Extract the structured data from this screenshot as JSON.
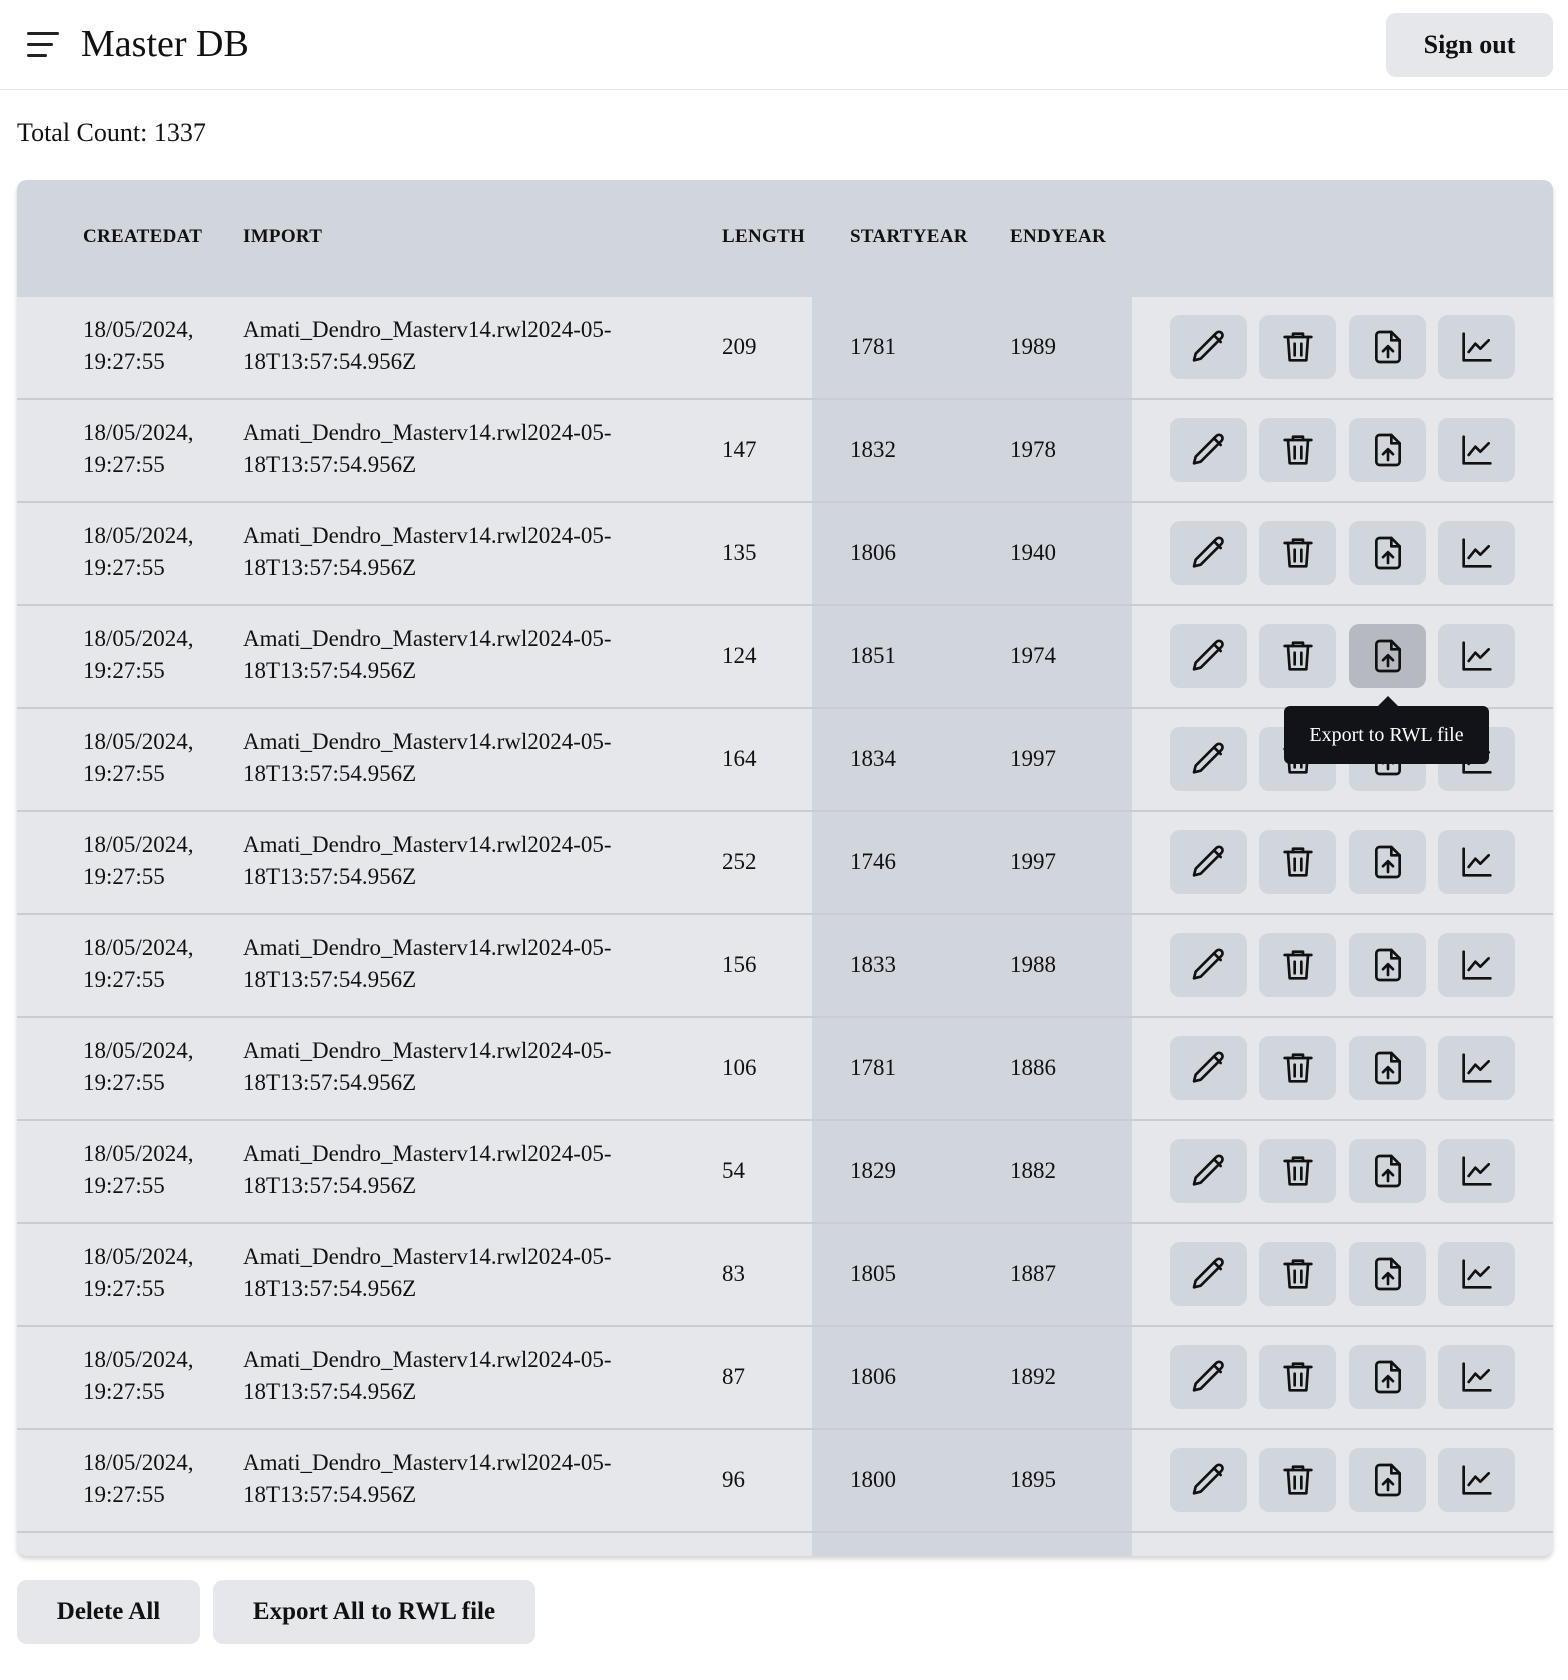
{
  "header": {
    "title": "Master DB",
    "signout_label": "Sign out",
    "menu_icon": "hamburger-menu-icon"
  },
  "summary": {
    "total_count": "Total Count: 1337"
  },
  "table": {
    "columns": [
      "CREATEDAT",
      "IMPORT",
      "LENGTH",
      "STARTYEAR",
      "ENDYEAR"
    ],
    "rows": [
      {
        "created_date": "18/05/2024,",
        "created_time": "19:27:55",
        "import_line1": "Amati_Dendro_Masterv14.rwl2024-05-",
        "import_line2": "18T13:57:54.956Z",
        "length": "209",
        "startyear": "1781",
        "endyear": "1989"
      },
      {
        "created_date": "18/05/2024,",
        "created_time": "19:27:55",
        "import_line1": "Amati_Dendro_Masterv14.rwl2024-05-",
        "import_line2": "18T13:57:54.956Z",
        "length": "147",
        "startyear": "1832",
        "endyear": "1978"
      },
      {
        "created_date": "18/05/2024,",
        "created_time": "19:27:55",
        "import_line1": "Amati_Dendro_Masterv14.rwl2024-05-",
        "import_line2": "18T13:57:54.956Z",
        "length": "135",
        "startyear": "1806",
        "endyear": "1940"
      },
      {
        "created_date": "18/05/2024,",
        "created_time": "19:27:55",
        "import_line1": "Amati_Dendro_Masterv14.rwl2024-05-",
        "import_line2": "18T13:57:54.956Z",
        "length": "124",
        "startyear": "1851",
        "endyear": "1974"
      },
      {
        "created_date": "18/05/2024,",
        "created_time": "19:27:55",
        "import_line1": "Amati_Dendro_Masterv14.rwl2024-05-",
        "import_line2": "18T13:57:54.956Z",
        "length": "164",
        "startyear": "1834",
        "endyear": "1997"
      },
      {
        "created_date": "18/05/2024,",
        "created_time": "19:27:55",
        "import_line1": "Amati_Dendro_Masterv14.rwl2024-05-",
        "import_line2": "18T13:57:54.956Z",
        "length": "252",
        "startyear": "1746",
        "endyear": "1997"
      },
      {
        "created_date": "18/05/2024,",
        "created_time": "19:27:55",
        "import_line1": "Amati_Dendro_Masterv14.rwl2024-05-",
        "import_line2": "18T13:57:54.956Z",
        "length": "156",
        "startyear": "1833",
        "endyear": "1988"
      },
      {
        "created_date": "18/05/2024,",
        "created_time": "19:27:55",
        "import_line1": "Amati_Dendro_Masterv14.rwl2024-05-",
        "import_line2": "18T13:57:54.956Z",
        "length": "106",
        "startyear": "1781",
        "endyear": "1886"
      },
      {
        "created_date": "18/05/2024,",
        "created_time": "19:27:55",
        "import_line1": "Amati_Dendro_Masterv14.rwl2024-05-",
        "import_line2": "18T13:57:54.956Z",
        "length": "54",
        "startyear": "1829",
        "endyear": "1882"
      },
      {
        "created_date": "18/05/2024,",
        "created_time": "19:27:55",
        "import_line1": "Amati_Dendro_Masterv14.rwl2024-05-",
        "import_line2": "18T13:57:54.956Z",
        "length": "83",
        "startyear": "1805",
        "endyear": "1887"
      },
      {
        "created_date": "18/05/2024,",
        "created_time": "19:27:55",
        "import_line1": "Amati_Dendro_Masterv14.rwl2024-05-",
        "import_line2": "18T13:57:54.956Z",
        "length": "87",
        "startyear": "1806",
        "endyear": "1892"
      },
      {
        "created_date": "18/05/2024,",
        "created_time": "19:27:55",
        "import_line1": "Amati_Dendro_Masterv14.rwl2024-05-",
        "import_line2": "18T13:57:54.956Z",
        "length": "96",
        "startyear": "1800",
        "endyear": "1895"
      }
    ],
    "row_actions": [
      "pencil-icon",
      "trash-icon",
      "file-upload-icon",
      "line-chart-icon"
    ],
    "hovered_row": 3
  },
  "tooltip": {
    "text": "Export to RWL file"
  },
  "footer": {
    "delete_all_label": "Delete All",
    "export_all_label": "Export All to RWL file"
  },
  "colors": {
    "header_bg": "#d1d5dc",
    "row_bg": "#e5e7eb",
    "button_bg": "#d1d5dc",
    "tooltip_bg": "#111318"
  }
}
